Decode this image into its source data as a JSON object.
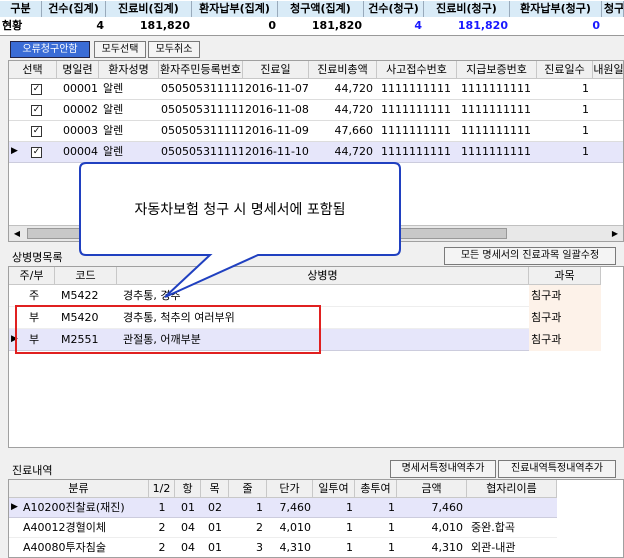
{
  "summary": {
    "headers": [
      "구분",
      "건수(집계)",
      "진료비(집계)",
      "환자납부(집계)",
      "청구액(집계)",
      "건수(청구)",
      "진료비(청구)",
      "환자납부(청구)",
      "청구"
    ],
    "values": [
      "현황",
      "4",
      "181,820",
      "0",
      "181,820",
      "4",
      "181,820",
      "0",
      ""
    ]
  },
  "toolbar": {
    "btn1": "오류청구안함",
    "btn2": "모두선택",
    "btn3": "모두취소"
  },
  "grid": {
    "headers": [
      "선택",
      "명일련",
      "환자성명",
      "환자주민등록번호",
      "진료일",
      "진료비총액",
      "사고접수번호",
      "지급보증번호",
      "진료일수",
      "내원일"
    ],
    "rows": [
      {
        "id": "00001",
        "name": "알렌",
        "ssn": "0505053111111",
        "date": "2016-11-07",
        "amt": "44,720",
        "acc": "1111111111",
        "pay": "1111111111",
        "days": "1"
      },
      {
        "id": "00002",
        "name": "알렌",
        "ssn": "0505053111111",
        "date": "2016-11-08",
        "amt": "44,720",
        "acc": "1111111111",
        "pay": "1111111111",
        "days": "1"
      },
      {
        "id": "00003",
        "name": "알렌",
        "ssn": "0505053111111",
        "date": "2016-11-09",
        "amt": "47,660",
        "acc": "1111111111",
        "pay": "1111111111",
        "days": "1"
      },
      {
        "id": "00004",
        "name": "알렌",
        "ssn": "0505053111111",
        "date": "2016-11-10",
        "amt": "44,720",
        "acc": "1111111111",
        "pay": "1111111111",
        "days": "1"
      }
    ]
  },
  "callout": "자동차보험 청구 시 명세서에 포함됨",
  "disease": {
    "title": "상병명목록",
    "btn": "모든 명세서의 진료과목 일괄수정",
    "headers": [
      "주/부",
      "코드",
      "상병명",
      "과목"
    ],
    "rows": [
      {
        "t": "주",
        "code": "M5422",
        "name": "경추통, 경추",
        "dept": "침구과"
      },
      {
        "t": "부",
        "code": "M5420",
        "name": "경추통, 척추의 여러부위",
        "dept": "침구과"
      },
      {
        "t": "부",
        "code": "M2551",
        "name": "관절통, 어깨부분",
        "dept": "침구과"
      }
    ]
  },
  "treat": {
    "title": "진료내역",
    "btn1": "명세서특정내역추가",
    "btn2": "진료내역특정내역추가",
    "headers": [
      "분류",
      "1/2",
      "항",
      "목",
      "줄",
      "단가",
      "일투여",
      "총투여",
      "금액",
      "협자리이름"
    ],
    "rows": [
      {
        "c": "A10200진찰료(재진)",
        "a": "1",
        "b": "01",
        "m": "02",
        "j": "1",
        "p": "7,460",
        "d": "1",
        "t": "1",
        "amt": "7,460",
        "note": ""
      },
      {
        "c": "A40012경혈이체",
        "a": "2",
        "b": "04",
        "m": "01",
        "j": "2",
        "p": "4,010",
        "d": "1",
        "t": "1",
        "amt": "4,010",
        "note": "중완.합곡"
      },
      {
        "c": "A40080투자침술",
        "a": "2",
        "b": "04",
        "m": "01",
        "j": "3",
        "p": "4,310",
        "d": "1",
        "t": "1",
        "amt": "4,310",
        "note": "외관-내관"
      }
    ]
  }
}
